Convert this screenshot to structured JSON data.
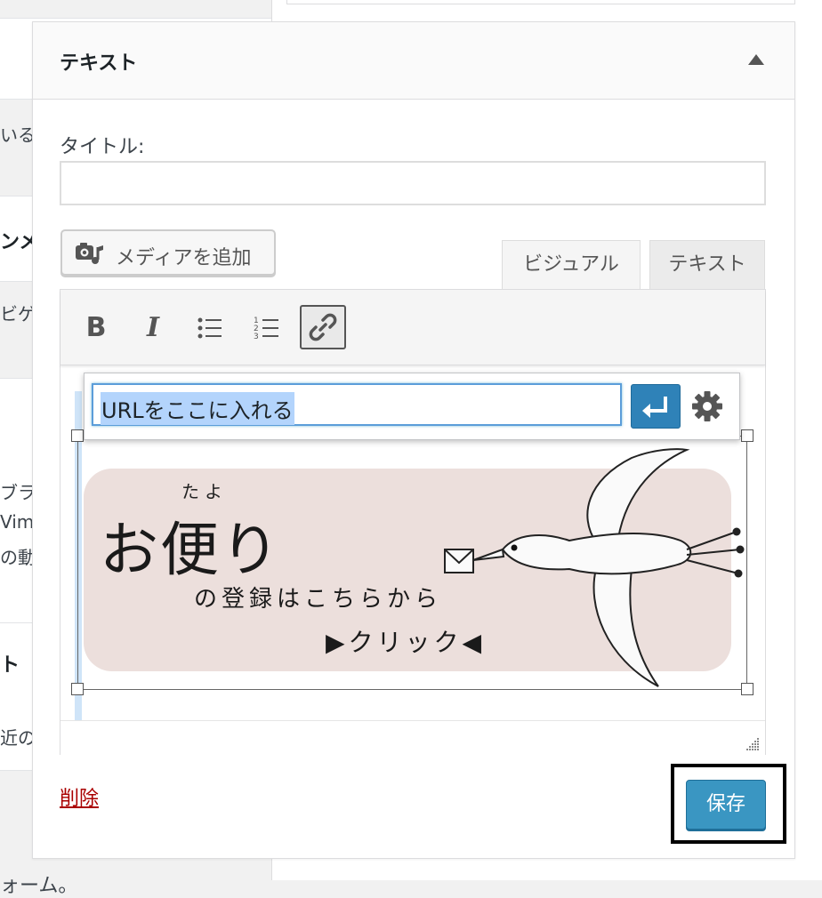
{
  "background": {
    "items": [
      "いる",
      "ンメ",
      "ビゲ",
      "ブラリ",
      "Vim",
      "の動",
      "ト",
      "近の"
    ],
    "footer": "ォーム。"
  },
  "widget": {
    "title": "テキスト",
    "title_label": "タイトル:",
    "title_value": "",
    "media_button": "メディアを追加",
    "tabs": {
      "visual": "ビジュアル",
      "text": "テキスト"
    },
    "toolbar": {
      "bold": "B",
      "italic": "I"
    },
    "link_popup": {
      "url_value": "URLをここに入れる"
    },
    "banner": {
      "ruby": "たよ",
      "main": "お便り",
      "sub": "の登録はこちらから",
      "click": "▶クリック◀"
    },
    "delete_label": "削除",
    "save_label": "保存"
  },
  "colors": {
    "primary_button": "#3a96c2",
    "apply_button": "#2f82b8",
    "delete_link": "#aa0000",
    "banner_bg": "#ecdfdc"
  },
  "icons": [
    "media-icon",
    "bulleted-list-icon",
    "numbered-list-icon",
    "link-icon",
    "return-icon",
    "gear-icon",
    "collapse-arrow-icon",
    "resize-grip-icon"
  ]
}
